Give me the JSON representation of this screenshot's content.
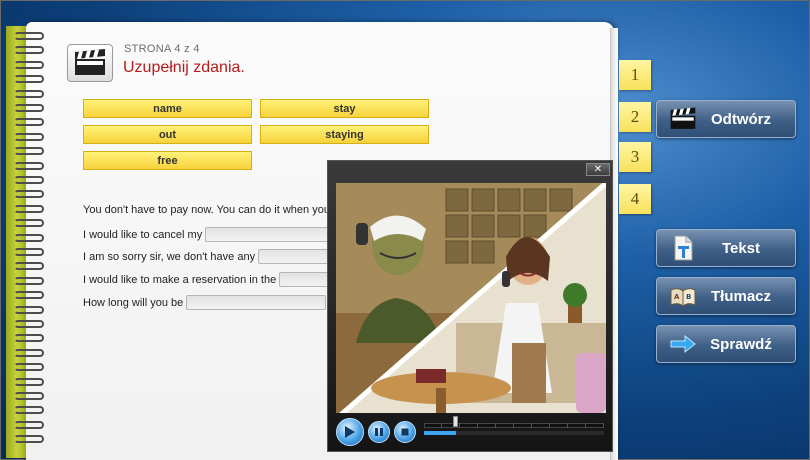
{
  "header": {
    "page_indicator": "STRONA 4 z 4",
    "title": "Uzupełnij zdania."
  },
  "word_bank": [
    "name",
    "stay",
    "out",
    "staying",
    "free"
  ],
  "sentences": [
    "You don't have to pay now. You can do it when you",
    "I would like to cancel my",
    "I am so sorry sir, we don't have any",
    "I would like to make a reservation in the",
    "How long will you be"
  ],
  "tabs": [
    "1",
    "2",
    "3",
    "4"
  ],
  "side_buttons": {
    "play": "Odtwórz",
    "text": "Tekst",
    "translator": "Tłumacz",
    "check": "Sprawdź"
  },
  "player": {
    "close_label": "✕",
    "progress": 0.18
  },
  "icons": {
    "header": "clapperboard-icon",
    "play_button": "clapperboard-icon",
    "text_button": "text-document-icon",
    "translator_button": "book-icon",
    "check_button": "arrow-right-icon"
  },
  "colors": {
    "title_red": "#b71c1c",
    "chip_yellow": "#f7d23a",
    "button_blue": "#3e5f86",
    "background_blue": "#1d5fa6",
    "spine_green": "#c5d23a",
    "progress_blue": "#3fa4ef"
  }
}
